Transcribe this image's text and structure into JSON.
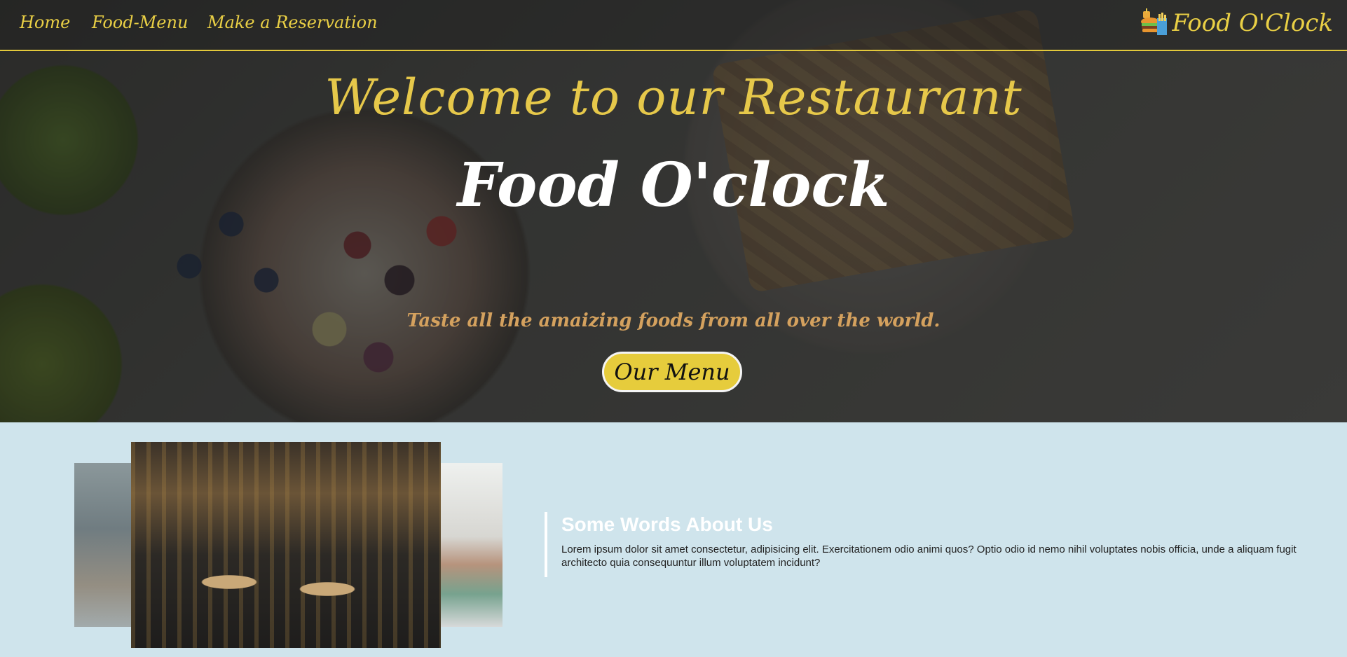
{
  "nav": {
    "items": [
      {
        "label": "Home"
      },
      {
        "label": "Food-Menu"
      },
      {
        "label": "Make a Reservation"
      }
    ],
    "brand": "Food O'Clock",
    "accent_color": "#e9cf45"
  },
  "hero": {
    "welcome": "Welcome to our Restaurant",
    "name": "Food O'clock",
    "tagline": "Taste all the amaizing foods from all over the world.",
    "button_label": "Our Menu"
  },
  "about": {
    "title": "Some Words About Us",
    "body": "Lorem ipsum dolor sit amet consectetur, adipisicing elit. Exercitationem odio animi quos? Optio odio id nemo nihil voluptates nobis officia, unde a aliquam fugit architecto quia consequuntur illum voluptatem incidunt?"
  }
}
